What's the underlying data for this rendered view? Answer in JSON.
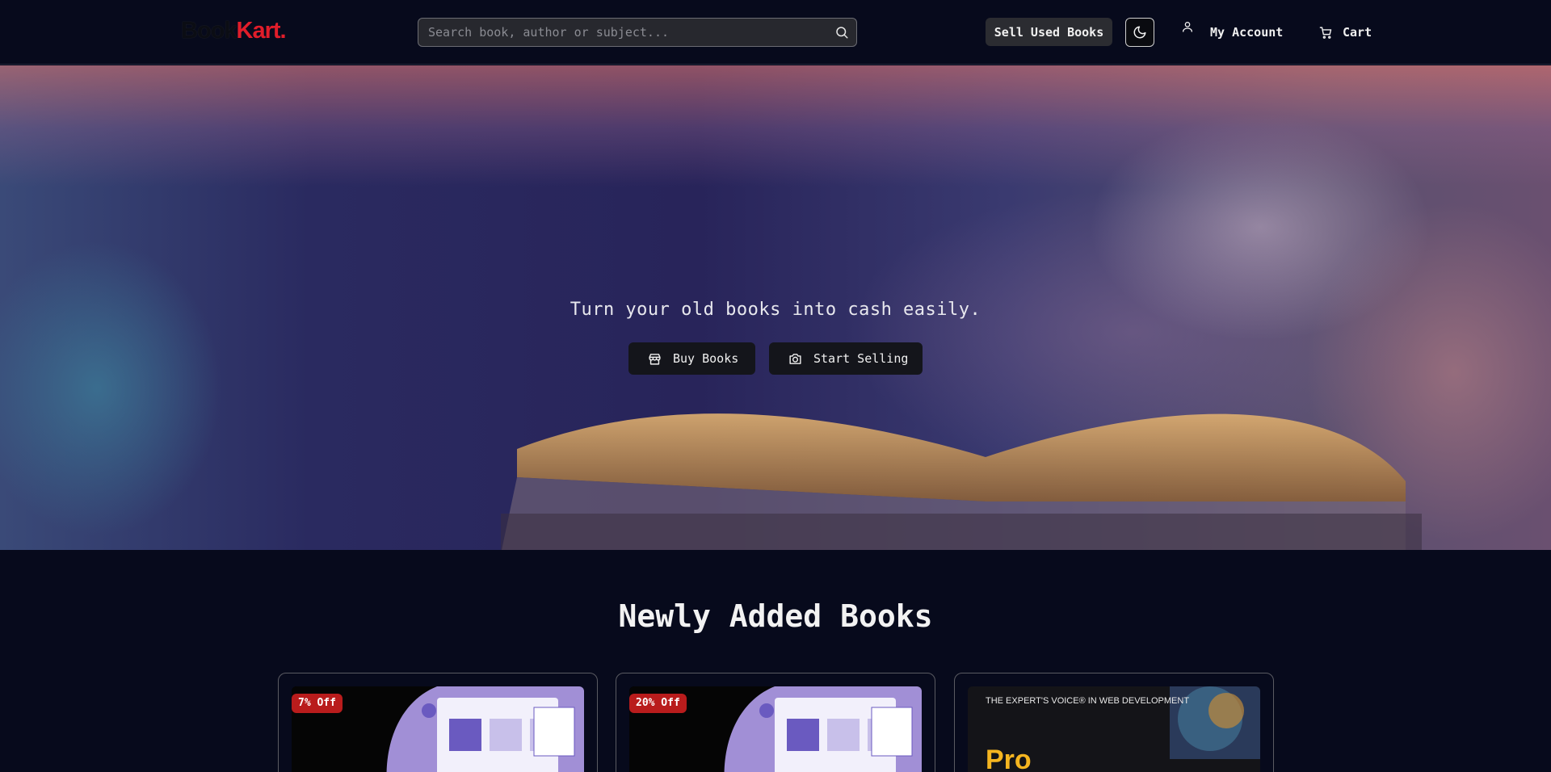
{
  "header": {
    "logo": {
      "part1": "Book",
      "part2": "Kart."
    },
    "search": {
      "placeholder": "Search book, author or subject..."
    },
    "sell_button": "Sell Used Books",
    "account_label": "My Account",
    "cart_label": "Cart"
  },
  "hero": {
    "tagline": "Turn your old books into cash easily.",
    "buy_label": "Buy Books",
    "sell_label": "Start Selling"
  },
  "new_books": {
    "title": "Newly Added Books",
    "cards": [
      {
        "badge": "7% Off"
      },
      {
        "badge": "20% Off"
      },
      {
        "cover_line": "THE EXPERT'S VOICE® IN WEB DEVELOPMENT",
        "cover_title": "Pro"
      }
    ]
  },
  "colors": {
    "background": "#070a1c",
    "accent_red": "#e11d2a",
    "badge_red": "#b91c1c"
  }
}
